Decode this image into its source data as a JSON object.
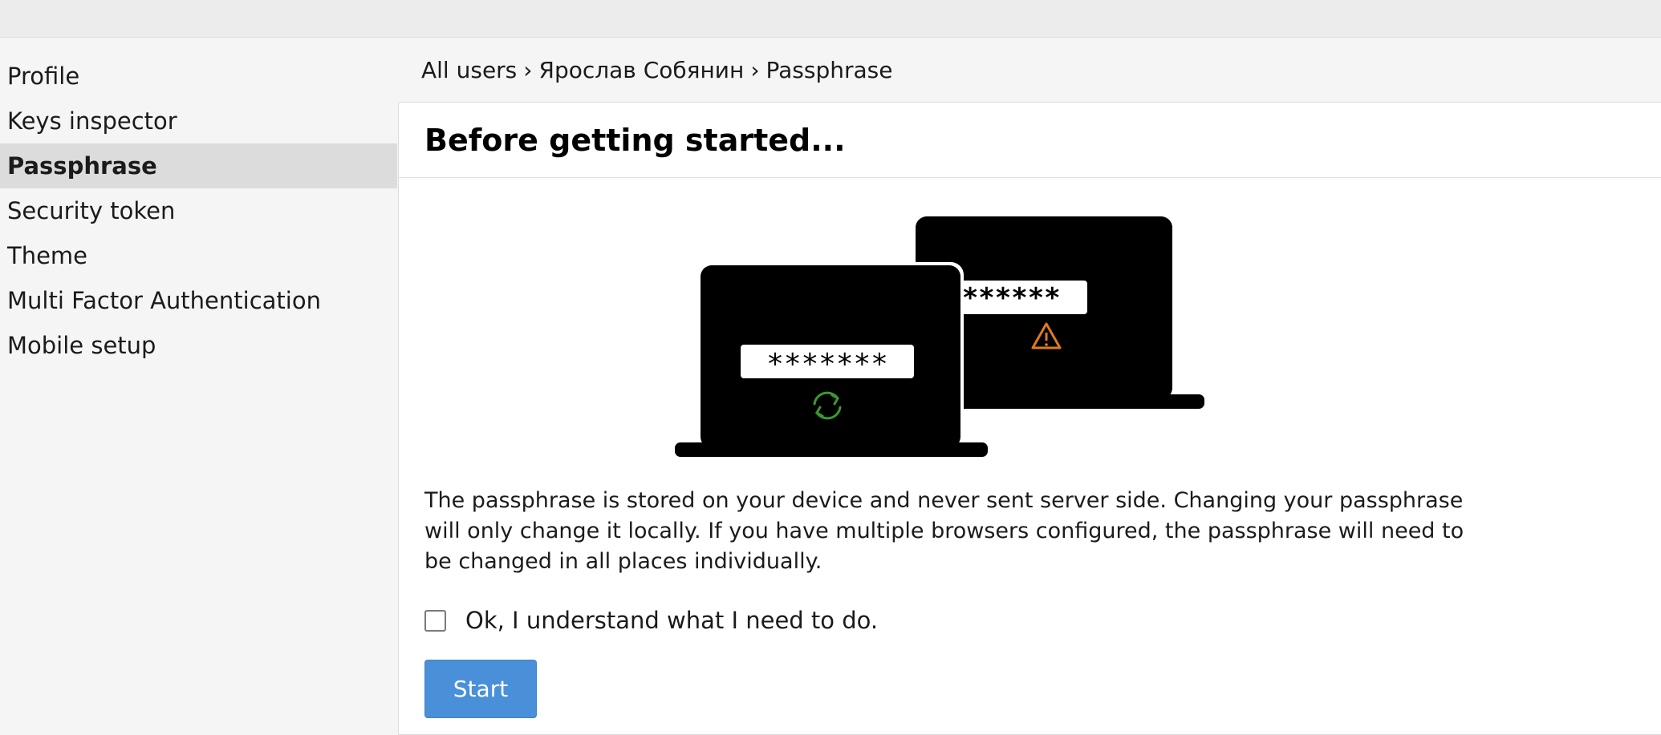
{
  "sidebar": {
    "items": [
      {
        "label": "Profile"
      },
      {
        "label": "Keys inspector"
      },
      {
        "label": "Passphrase"
      },
      {
        "label": "Security token"
      },
      {
        "label": "Theme"
      },
      {
        "label": "Multi Factor Authentication"
      },
      {
        "label": "Mobile setup"
      }
    ],
    "active": "Passphrase"
  },
  "breadcrumb": {
    "items": [
      "All users",
      "Ярослав Собянин",
      "Passphrase"
    ],
    "separator": "›"
  },
  "panel": {
    "title": "Before getting started...",
    "illustration": {
      "front_password": "*******",
      "back_password": "*******",
      "sync_icon": "sync-icon",
      "warning_icon": "warning-icon",
      "sync_color": "#3a9a2e",
      "warning_color": "#e07a1f"
    },
    "description": "The passphrase is stored on your device and never sent server side. Changing your passphrase will only change it locally. If you have multiple browsers configured, the passphrase will need to be changed in all places individually.",
    "checkbox": {
      "label": "Ok, I understand what I need to do.",
      "checked": false
    },
    "start_button": "Start"
  },
  "colors": {
    "accent": "#4a90d9",
    "active_item_bg": "#dcdcdc",
    "page_bg": "#f5f5f5",
    "topbar_bg": "#ececec"
  }
}
